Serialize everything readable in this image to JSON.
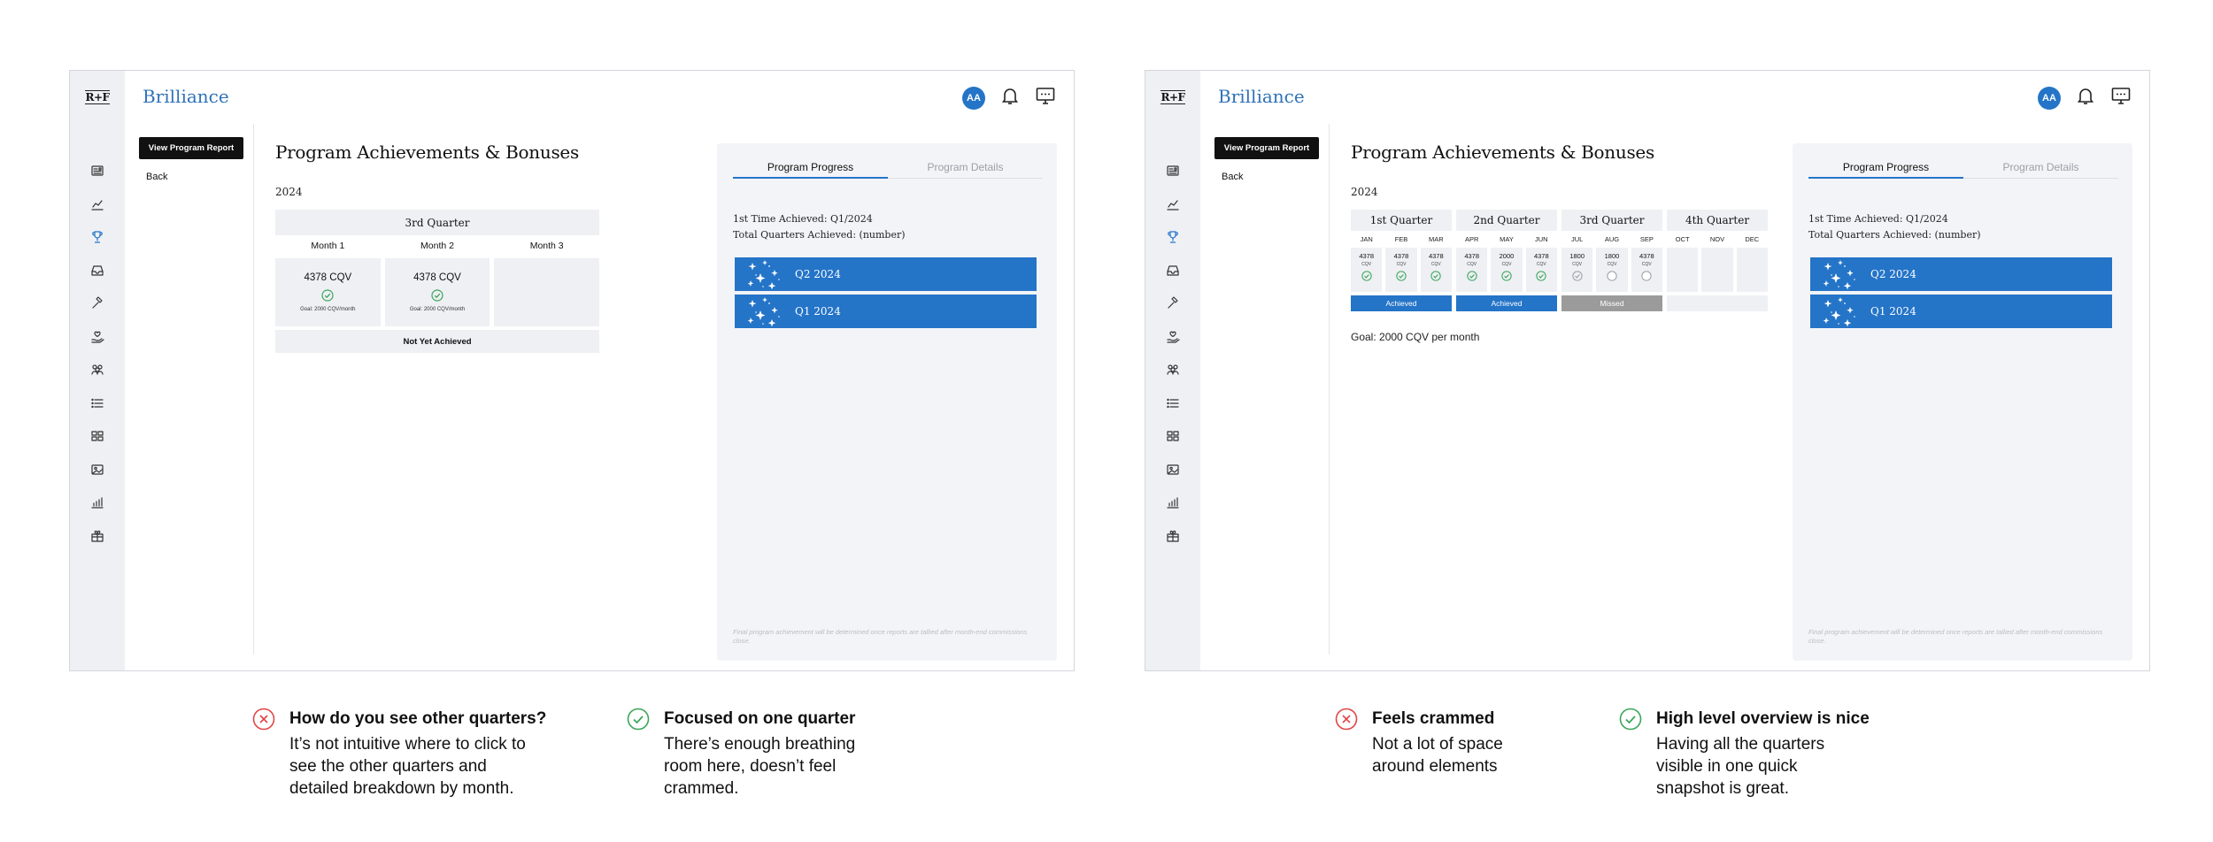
{
  "app": {
    "logo": "R+F",
    "brand": "Brilliance",
    "avatar_initials": "AA",
    "accent_color": "#2474c8",
    "subnav": {
      "view_report_label": "View Program Report",
      "back_label": "Back"
    },
    "page_title": "Program Achievements & Bonuses",
    "year": "2024",
    "sidebar_icons": [
      "news-icon",
      "chart-line-icon",
      "trophy-icon",
      "inbox-icon",
      "hammer-icon",
      "hand-heart-icon",
      "people-icon",
      "list-icon",
      "grid-dashboard-icon",
      "image-gallery-icon",
      "bar-chart-icon",
      "gift-icon"
    ],
    "progress": {
      "tab_active": "Program Progress",
      "tab_other": "Program Details",
      "first_time": "1st Time Achieved: Q1/2024",
      "total": "Total Quarters Achieved: (number)",
      "bars": [
        "Q2 2024",
        "Q1 2024"
      ],
      "fine_print": "Final program achievement will be determined once reports are tallied after month-end commissions close."
    }
  },
  "optionA": {
    "quarter": "3rd Quarter",
    "months": [
      {
        "label": "Month 1",
        "value": "4378 CQV",
        "goal": "Goal: 2000 CQV/month",
        "achieved": true
      },
      {
        "label": "Month 2",
        "value": "4378 CQV",
        "goal": "Goal: 2000 CQV/month",
        "achieved": true
      },
      {
        "label": "Month 3",
        "value": "",
        "goal": "",
        "achieved": false
      }
    ],
    "status": "Not Yet Achieved"
  },
  "optionB": {
    "unit": "CQV",
    "goal": "Goal: 2000 CQV per month",
    "quarters": [
      {
        "name": "1st Quarter",
        "months": [
          "JAN",
          "FEB",
          "MAR"
        ],
        "values": [
          "4378",
          "4378",
          "4378"
        ],
        "checks": [
          "done",
          "done",
          "done"
        ],
        "status": "Achieved"
      },
      {
        "name": "2nd Quarter",
        "months": [
          "APR",
          "MAY",
          "JUN"
        ],
        "values": [
          "4378",
          "2000",
          "4378"
        ],
        "checks": [
          "done",
          "done",
          "done"
        ],
        "status": "Achieved"
      },
      {
        "name": "3rd Quarter",
        "months": [
          "JUL",
          "AUG",
          "SEP"
        ],
        "values": [
          "1800",
          "1800",
          "4378"
        ],
        "checks": [
          "partial",
          "none",
          "none"
        ],
        "status": "Missed"
      },
      {
        "name": "4th Quarter",
        "months": [
          "OCT",
          "NOV",
          "DEC"
        ],
        "values": [
          "",
          "",
          ""
        ],
        "checks": [
          "",
          "",
          ""
        ],
        "status": ""
      }
    ]
  },
  "notes": [
    {
      "type": "con",
      "title": "How do you see other quarters?",
      "lines": [
        "It’s not intuitive where to click to",
        "see the other quarters and",
        "detailed breakdown by month."
      ]
    },
    {
      "type": "pro",
      "title": "Focused on one quarter",
      "lines": [
        "There’s enough breathing",
        "room here, doesn’t feel",
        "crammed."
      ]
    },
    {
      "type": "con",
      "title": "Feels crammed",
      "lines": [
        "Not a lot of space",
        "around elements"
      ]
    },
    {
      "type": "pro",
      "title": "High level overview is nice",
      "lines": [
        "Having all the quarters",
        "visible in one quick",
        "snapshot is great."
      ]
    }
  ]
}
